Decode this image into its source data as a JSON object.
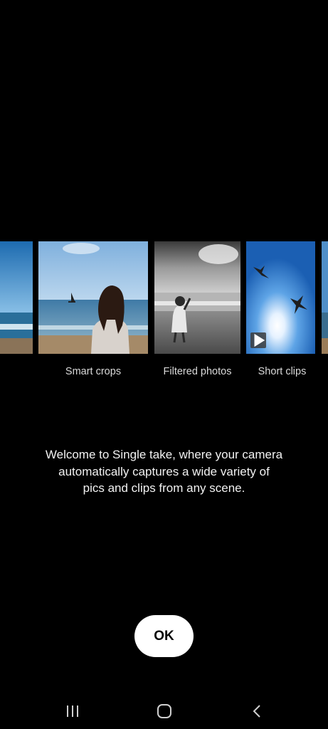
{
  "carousel": {
    "items": [
      {
        "label": "Smart crops",
        "image": "woman-on-beach-photo"
      },
      {
        "label": "Filtered photos",
        "image": "black-and-white-beach-photo"
      },
      {
        "label": "Short clips",
        "image": "seagulls-sky-video"
      }
    ],
    "play_icon": "play-icon"
  },
  "message": {
    "line1": "Welcome to Single take, where your camera",
    "line2": "automatically captures a wide variety of",
    "line3": "pics and clips from any scene."
  },
  "ok_label": "OK",
  "navbar": {
    "recents_icon": "recents-icon",
    "home_icon": "home-icon",
    "back_icon": "back-icon"
  },
  "colors": {
    "background": "#000000",
    "button_bg": "#ffffff",
    "button_text": "#000000",
    "caption_text": "#d9d9d9"
  }
}
